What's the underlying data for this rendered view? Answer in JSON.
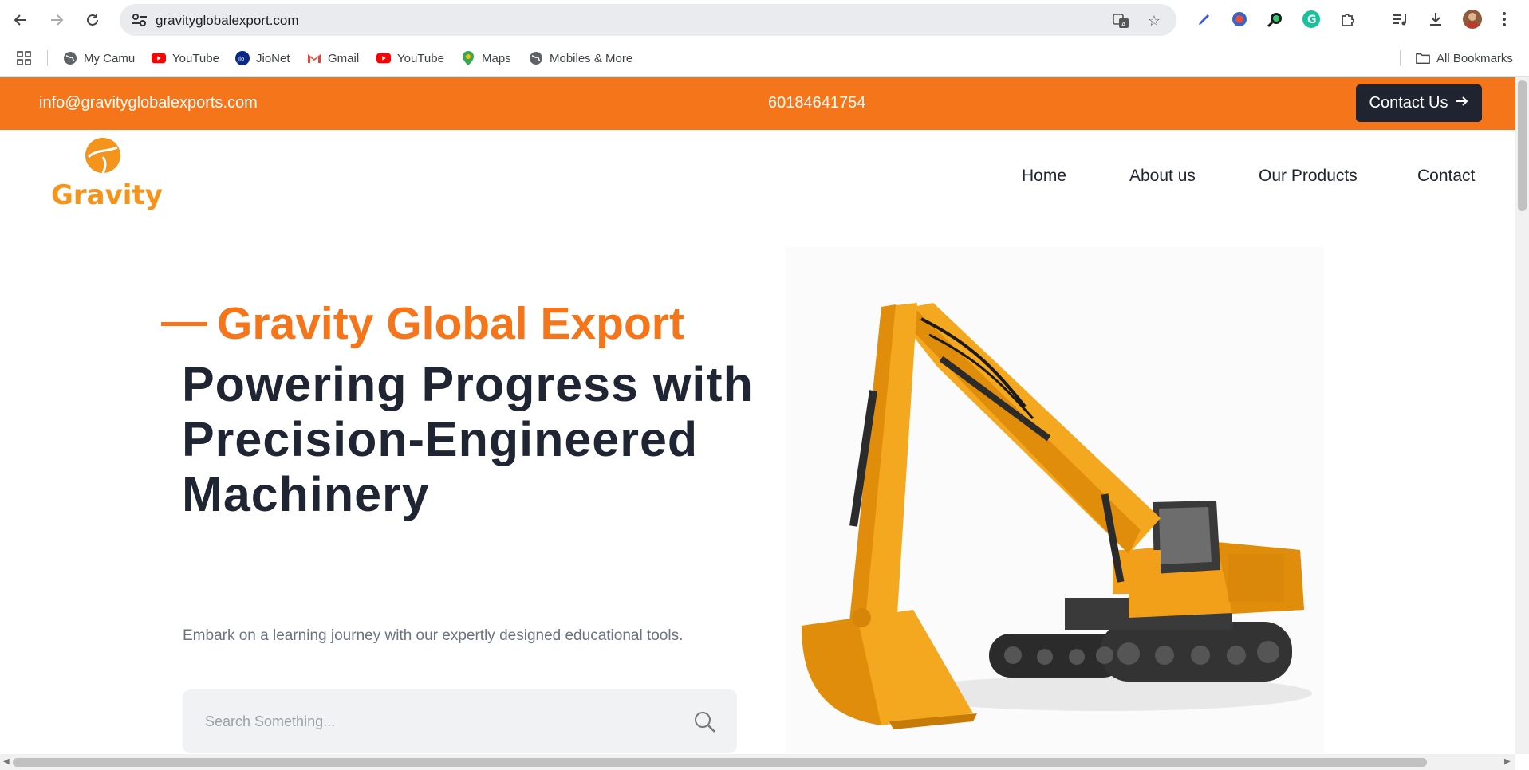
{
  "browser": {
    "url": "gravityglobalexport.com",
    "bookmarks": [
      {
        "label": "My Camu",
        "icon": "globe-icon"
      },
      {
        "label": "YouTube",
        "icon": "youtube-icon"
      },
      {
        "label": "JioNet",
        "icon": "jio-icon"
      },
      {
        "label": "Gmail",
        "icon": "gmail-icon"
      },
      {
        "label": "YouTube",
        "icon": "youtube-icon"
      },
      {
        "label": "Maps",
        "icon": "maps-icon"
      },
      {
        "label": "Mobiles & More",
        "icon": "globe-icon"
      }
    ],
    "all_bookmarks": "All Bookmarks"
  },
  "topbar": {
    "email": "info@gravityglobalexports.com",
    "phone": "60184641754",
    "contact_button": "Contact Us"
  },
  "navbar": {
    "logo_text": "Gravity",
    "links": [
      "Home",
      "About us",
      "Our Products",
      "Contact"
    ]
  },
  "hero": {
    "tagline": "Gravity Global Export",
    "title": "Powering Progress with Precision-Engineered Machinery",
    "subtitle": "Embark on a learning journey with our expertly designed educational tools.",
    "search_placeholder": "Search Something..."
  },
  "colors": {
    "accent": "#f5751a",
    "dark": "#1f2533",
    "logo": "#f5941a"
  }
}
